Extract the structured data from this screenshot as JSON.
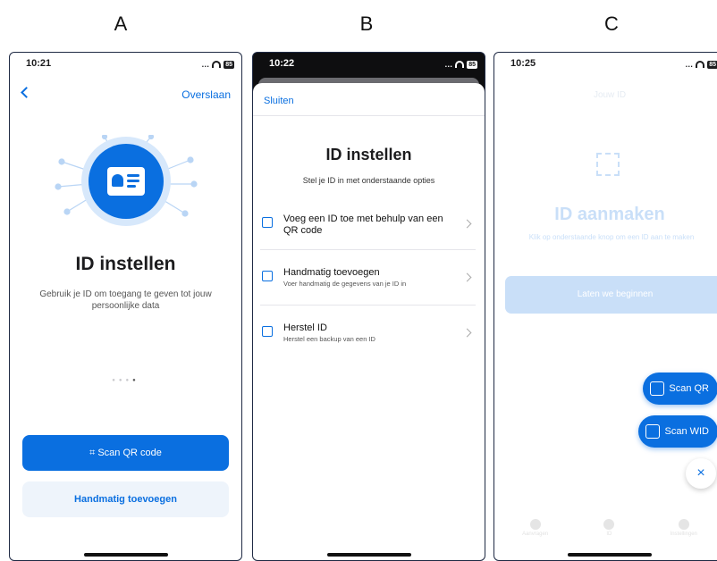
{
  "labels": {
    "a": "A",
    "b": "B",
    "c": "C"
  },
  "colors": {
    "accent": "#0a6fe0",
    "accent_light": "#eef4fb"
  },
  "phone_a": {
    "status_time": "10:21",
    "battery": "85",
    "skip": "Overslaan",
    "title": "ID instellen",
    "subtitle": "Gebruik je ID om toegang te geven tot jouw persoonlijke data",
    "primary_button": "Scan QR code",
    "secondary_button": "Handmatig toevoegen"
  },
  "phone_b": {
    "status_time": "10:22",
    "battery": "85",
    "close": "Sluiten",
    "title": "ID instellen",
    "subtitle": "Stel je ID in met onderstaande opties",
    "options": [
      {
        "title": "Voeg een ID toe met behulp van een QR code",
        "desc": "",
        "icon": "qr-icon"
      },
      {
        "title": "Handmatig toevoegen",
        "desc": "Voer handmatig de gegevens van je ID in",
        "icon": "keyboard-icon"
      },
      {
        "title": "Herstel ID",
        "desc": "Herstel een backup van een ID",
        "icon": "restore-icon"
      }
    ]
  },
  "phone_c": {
    "status_time": "10:25",
    "battery": "85",
    "header": "Jouw ID",
    "title": "ID aanmaken",
    "subtitle": "Klik op onderstaande knop om een ID aan te maken",
    "start_button": "Laten we beginnen",
    "fab_scan_qr": "Scan QR",
    "fab_scan_wid": "Scan WID",
    "fab_close": "×",
    "tabs": [
      "Aanvragen",
      "ID",
      "Instellingen"
    ]
  }
}
